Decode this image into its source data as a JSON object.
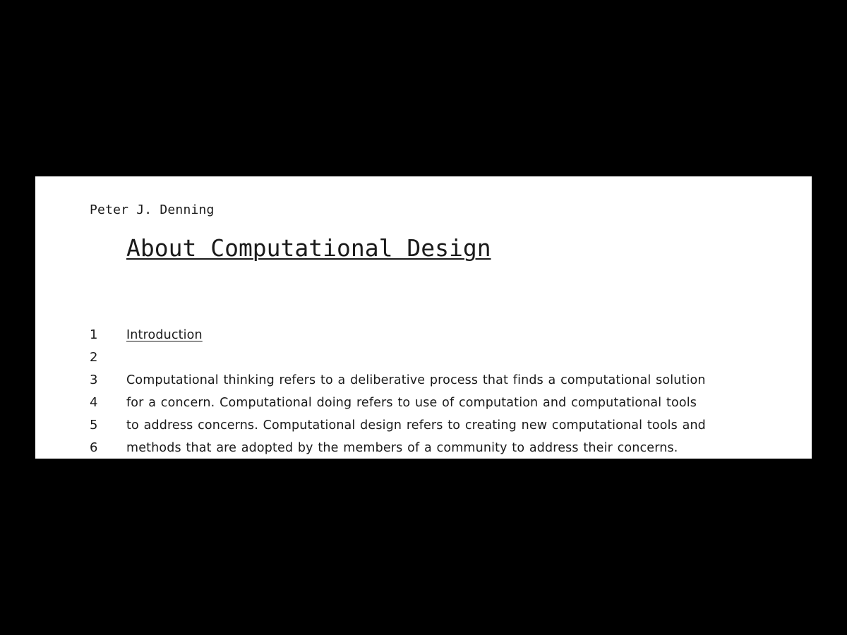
{
  "document": {
    "author": "Peter J. Denning",
    "title": "About Computational Design",
    "lines": [
      {
        "number": "1",
        "text": "Introduction",
        "heading": true
      },
      {
        "number": "2",
        "text": ""
      },
      {
        "number": "3",
        "text": "Computational thinking refers to a deliberative process that finds a computational solution"
      },
      {
        "number": "4",
        "text": "for a concern. Computational doing refers to use of computation and computational tools"
      },
      {
        "number": "5",
        "text": "to address concerns. Computational design refers to creating new computational tools and"
      },
      {
        "number": "6",
        "text": "methods that are adopted by the members of a community to address their concerns."
      }
    ]
  }
}
